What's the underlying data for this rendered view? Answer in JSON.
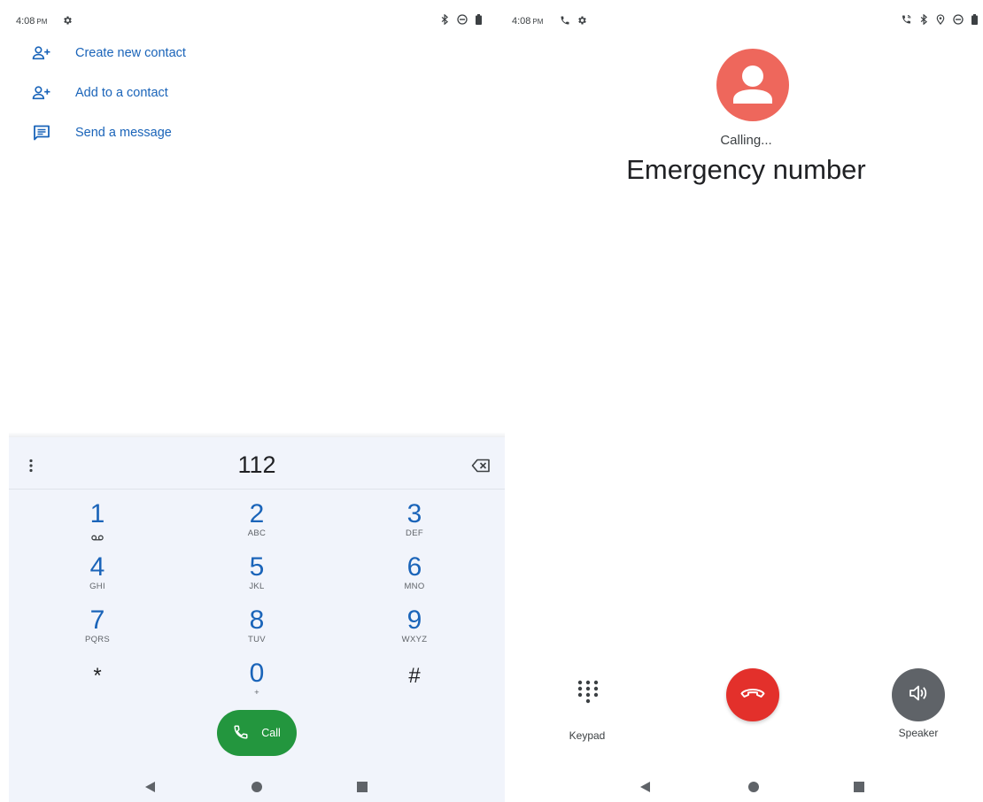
{
  "left": {
    "status": {
      "time": "4:08",
      "ampm": "PM"
    },
    "menu": [
      {
        "label": "Create new contact",
        "icon": "person-add-icon"
      },
      {
        "label": "Add to a contact",
        "icon": "person-add-icon"
      },
      {
        "label": "Send a message",
        "icon": "message-icon"
      }
    ],
    "dialpad": {
      "digits": "112",
      "keys": [
        {
          "num": "1",
          "sub": ""
        },
        {
          "num": "2",
          "sub": "ABC"
        },
        {
          "num": "3",
          "sub": "DEF"
        },
        {
          "num": "4",
          "sub": "GHI"
        },
        {
          "num": "5",
          "sub": "JKL"
        },
        {
          "num": "6",
          "sub": "MNO"
        },
        {
          "num": "7",
          "sub": "PQRS"
        },
        {
          "num": "8",
          "sub": "TUV"
        },
        {
          "num": "9",
          "sub": "WXYZ"
        },
        {
          "num": "*",
          "sub": ""
        },
        {
          "num": "0",
          "sub": "+"
        },
        {
          "num": "#",
          "sub": ""
        }
      ],
      "call_label": "Call"
    }
  },
  "right": {
    "status": {
      "time": "4:08",
      "ampm": "PM"
    },
    "calling_status": "Calling...",
    "caller_name": "Emergency number",
    "keypad_label": "Keypad",
    "speaker_label": "Speaker"
  },
  "colors": {
    "accent": "#1a64b9",
    "dialpad_bg": "#f1f4fb",
    "call_green": "#23963e",
    "end_call_red": "#e3302b",
    "avatar": "#ee675c",
    "speaker_gray": "#5f6368"
  }
}
